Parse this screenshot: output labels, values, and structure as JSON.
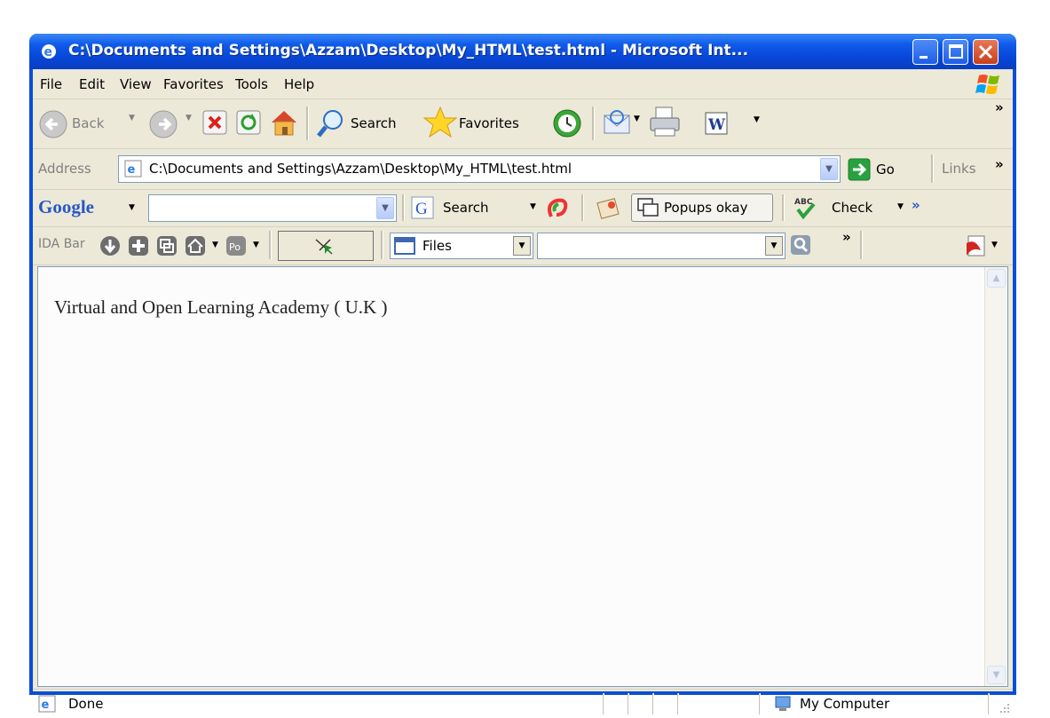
{
  "window": {
    "title": "C:\\Documents and Settings\\Azzam\\Desktop\\My_HTML\\test.html - Microsoft Int..."
  },
  "menu": [
    "File",
    "Edit",
    "View",
    "Favorites",
    "Tools",
    "Help"
  ],
  "toolbar": {
    "back": "Back",
    "search": "Search",
    "favorites": "Favorites",
    "overflow": "»"
  },
  "address": {
    "label": "Address",
    "value": "C:\\Documents and Settings\\Azzam\\Desktop\\My_HTML\\test.html",
    "go": "Go",
    "links": "Links",
    "overflow": "»"
  },
  "google": {
    "logo": "Google",
    "search": "Search",
    "popups": "Popups okay",
    "check": "Check",
    "overflow": "»"
  },
  "ida": {
    "label": "IDA Bar",
    "files": "Files",
    "overflow": "»"
  },
  "page": {
    "text": "Virtual and Open Learning Academy ( U.K )"
  },
  "status": {
    "text": "Done",
    "zone": "My Computer"
  },
  "colors": {
    "titlebar": "#0a4ed4",
    "chrome": "#ece9d8",
    "close": "#c6401d"
  }
}
